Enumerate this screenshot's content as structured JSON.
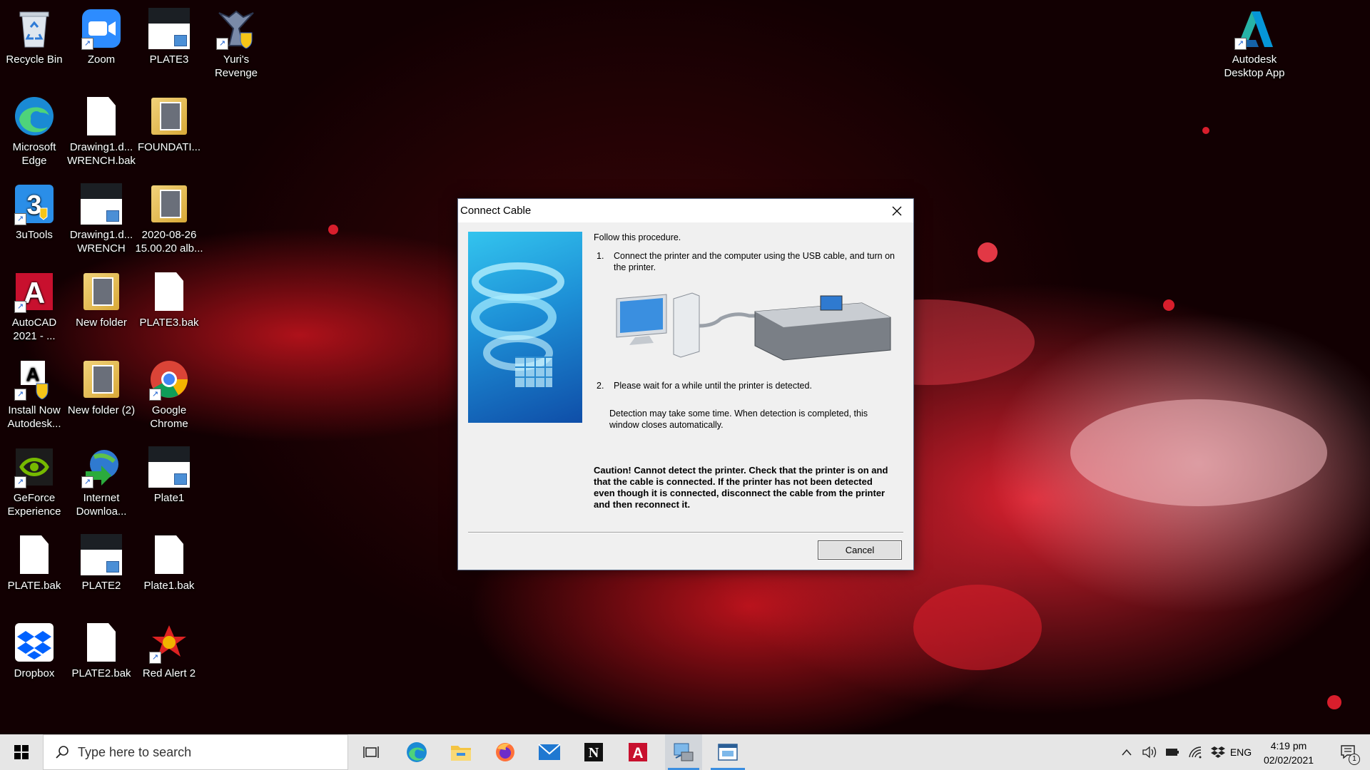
{
  "desktop_icons": [
    {
      "label": "Recycle Bin",
      "icon": "recycle-bin-icon"
    },
    {
      "label": "Zoom",
      "icon": "zoom-icon"
    },
    {
      "label": "PLATE3",
      "icon": "dwg-file-icon"
    },
    {
      "label": "Yuri's Revenge",
      "icon": "yuris-revenge-icon"
    },
    {
      "label": "Microsoft Edge",
      "icon": "edge-icon"
    },
    {
      "label": "Drawing1.d... WRENCH.bak",
      "icon": "file-icon"
    },
    {
      "label": "FOUNDATI...",
      "icon": "folder-icon"
    },
    {
      "label": "3uTools",
      "icon": "3utools-icon"
    },
    {
      "label": "Drawing1.d... WRENCH",
      "icon": "dwg-file-icon"
    },
    {
      "label": "2020-08-26 15.00.20 alb...",
      "icon": "folder-icon"
    },
    {
      "label": "AutoCAD 2021 - ...",
      "icon": "autocad-icon"
    },
    {
      "label": "New folder",
      "icon": "folder-icon"
    },
    {
      "label": "PLATE3.bak",
      "icon": "file-icon"
    },
    {
      "label": "Install Now Autodesk...",
      "icon": "autodesk-install-icon"
    },
    {
      "label": "New folder (2)",
      "icon": "folder-icon"
    },
    {
      "label": "Google Chrome",
      "icon": "chrome-icon"
    },
    {
      "label": "GeForce Experience",
      "icon": "geforce-icon"
    },
    {
      "label": "Internet Downloa...",
      "icon": "idm-icon"
    },
    {
      "label": "Plate1",
      "icon": "dwg-file-icon"
    },
    {
      "label": "PLATE.bak",
      "icon": "file-icon"
    },
    {
      "label": "PLATE2",
      "icon": "dwg-file-icon"
    },
    {
      "label": "Plate1.bak",
      "icon": "file-icon"
    },
    {
      "label": "Dropbox",
      "icon": "dropbox-icon"
    },
    {
      "label": "PLATE2.bak",
      "icon": "file-icon"
    },
    {
      "label": "Red Alert 2",
      "icon": "red-alert-icon"
    },
    {
      "label": "Autodesk Desktop App",
      "icon": "autodesk-desktop-app-icon"
    }
  ],
  "dialog": {
    "title": "Connect Cable",
    "intro": "Follow this procedure.",
    "step1_num": "1.",
    "step1": "Connect the printer and the computer using the USB cable, and turn on the printer.",
    "step2_num": "2.",
    "step2": "Please wait for a while until the printer is detected.",
    "detection_note": "Detection may take some time. When detection is completed, this window closes automatically.",
    "caution": "Caution! Cannot detect the printer. Check that the printer is on and that the cable is connected. If the printer has not been detected even though it is connected, disconnect the cable from the printer and then reconnect it.",
    "cancel_label": "Cancel"
  },
  "taskbar": {
    "search_placeholder": "Type here to search",
    "pinned": [
      "task-view-icon",
      "edge-icon",
      "file-explorer-icon",
      "firefox-icon",
      "mail-icon",
      "notion-icon",
      "autocad-icon",
      "printer-setup-icon",
      "active-window-icon"
    ],
    "language": "ENG",
    "time": "4:19 pm",
    "date": "02/02/2021",
    "notification_count": "1"
  },
  "colors": {
    "accent": "#3b8ee0",
    "wallpaper_red": "#d81e2c",
    "taskbar_bg": "#e6e6e6"
  }
}
